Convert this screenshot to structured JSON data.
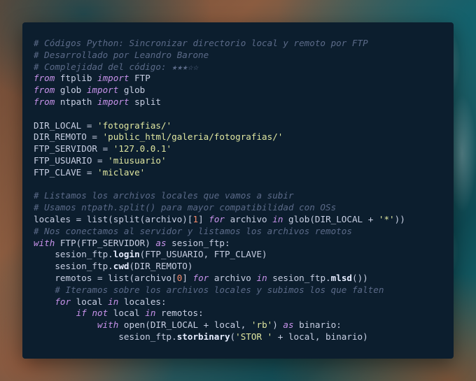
{
  "code_lines": [
    "# Códigos Python: Sincronizar directorio local y remoto por FTP",
    "# Desarrollado por Leandro Barone",
    "# Complejidad del código: ★★★☆☆",
    "from ftplib import FTP",
    "from glob import glob",
    "from ntpath import split",
    "",
    "DIR_LOCAL = 'fotografias/'",
    "DIR_REMOTO = 'public_html/galeria/fotografias/'",
    "FTP_SERVIDOR = '127.0.0.1'",
    "FTP_USUARIO = 'miusuario'",
    "FTP_CLAVE = 'miclave'",
    "",
    "# Listamos los archivos locales que vamos a subir",
    "# Usamos ntpath.split() para mayor compatibilidad con OSs",
    "locales = list(split(archivo)[1] for archivo in glob(DIR_LOCAL + '*'))",
    "# Nos conectamos al servidor y listamos los archivos remotos",
    "with FTP(FTP_SERVIDOR) as sesion_ftp:",
    "    sesion_ftp.login(FTP_USUARIO, FTP_CLAVE)",
    "    sesion_ftp.cwd(DIR_REMOTO)",
    "    remotos = list(archivo[0] for archivo in sesion_ftp.mlsd())",
    "    # Iteramos sobre los archivos locales y subimos los que falten",
    "    for local in locales:",
    "        if not local in remotos:",
    "            with open(DIR_LOCAL + local, 'rb') as binario:",
    "                sesion_ftp.storbinary('STOR ' + local, binario)"
  ],
  "colors": {
    "card_background": "#0c1e2e",
    "comment": "#5b6a88",
    "keyword": "#c792ea",
    "string": "#dfe6a0",
    "number": "#f78c6c",
    "text": "#c8cfe3"
  }
}
